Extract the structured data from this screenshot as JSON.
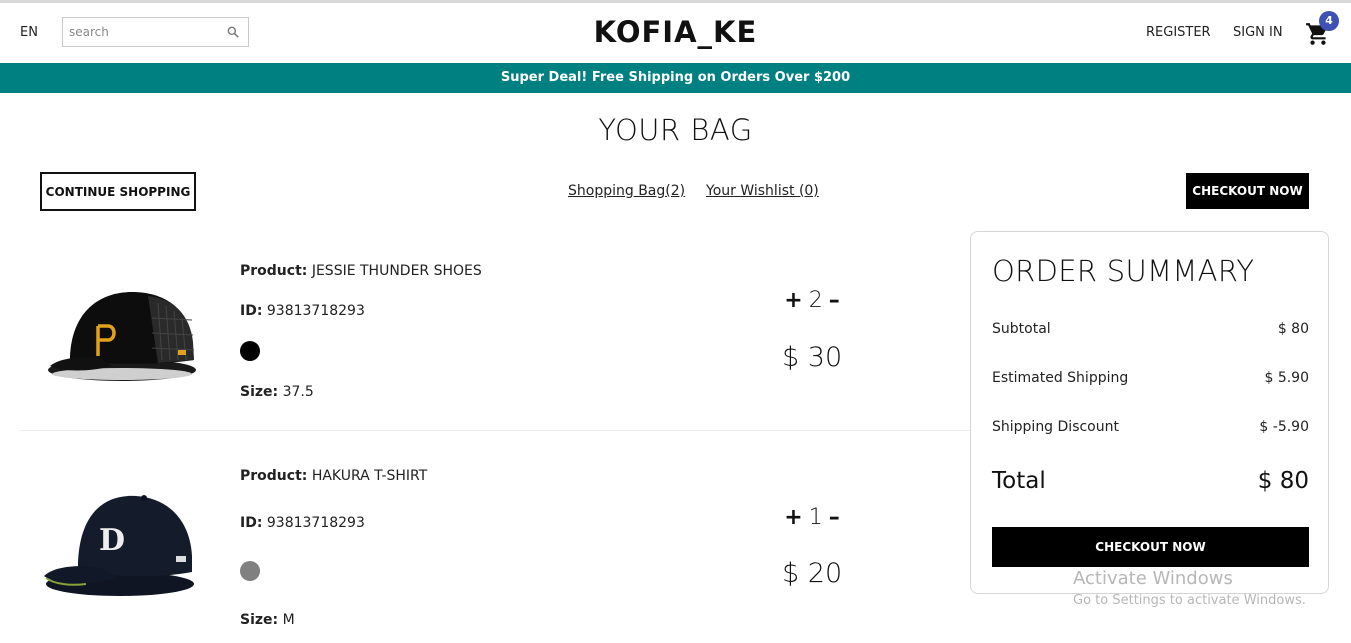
{
  "navbar": {
    "language": "EN",
    "search_placeholder": "search",
    "brand": "KOFIA_KE",
    "register": "REGISTER",
    "sign_in": "SIGN IN",
    "cart_count": "4",
    "badge_color": "#3f51b5"
  },
  "announcement": {
    "text": "Super Deal! Free Shipping on Orders Over $200",
    "color": "#008080"
  },
  "page": {
    "title": "YOUR BAG",
    "continue_label": "CONTINUE SHOPPING",
    "bag_tab": "Shopping Bag(2)",
    "wishlist_tab": "Your Wishlist (0)",
    "checkout_label": "CHECKOUT NOW"
  },
  "products": [
    {
      "product_label": "Product:",
      "product_name": "JESSIE THUNDER SHOES",
      "id_label": "ID:",
      "id": "93813718293",
      "color": "#000000",
      "size_label": "Size:",
      "size": "37.5",
      "quantity": "2",
      "price": "$ 30",
      "image": "black-trucker-cap-icon"
    },
    {
      "product_label": "Product:",
      "product_name": "HAKURA T-SHIRT",
      "id_label": "ID:",
      "id": "93813718293",
      "color": "#808080",
      "size_label": "Size:",
      "size": "M",
      "quantity": "1",
      "price": "$ 20",
      "image": "navy-fitted-cap-icon"
    }
  ],
  "summary": {
    "title": "ORDER SUMMARY",
    "subtotal_label": "Subtotal",
    "subtotal": "$ 80",
    "shipping_label": "Estimated Shipping",
    "shipping": "$ 5.90",
    "discount_label": "Shipping Discount",
    "discount": "$ -5.90",
    "total_label": "Total",
    "total": "$ 80",
    "checkout_label": "CHECKOUT NOW"
  },
  "watermark": {
    "line1": "Activate Windows",
    "line2": "Go to Settings to activate Windows."
  }
}
